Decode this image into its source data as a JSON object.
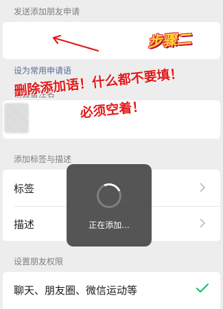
{
  "request_section": {
    "label": "发送添加朋友申请",
    "input_value": ""
  },
  "common_request_link": "设为常用申请语",
  "remark_section": {
    "label": "设置备注名"
  },
  "tags_section": {
    "label": "添加标签与描述",
    "rows": [
      {
        "label": "标签"
      },
      {
        "label": "描述"
      }
    ]
  },
  "permissions_section": {
    "label": "设置朋友权限",
    "selected_option": "聊天、朋友圈、微信运动等"
  },
  "toast": {
    "text": "正在添加..."
  },
  "annotations": {
    "step_badge": "步骤二",
    "note_line1": "删除添加语！什么都不要填！",
    "note_line2": "必须空着！",
    "note_color": "#e01919"
  },
  "icons": {
    "chevron": "chevron-right-icon",
    "check": "check-icon",
    "arrow": "arrow-icon",
    "spinner": "spinner-icon"
  },
  "colors": {
    "background": "#ededed",
    "card": "#ffffff",
    "link": "#576b95",
    "check": "#07c160",
    "toast_bg": "#4c4c4c"
  }
}
